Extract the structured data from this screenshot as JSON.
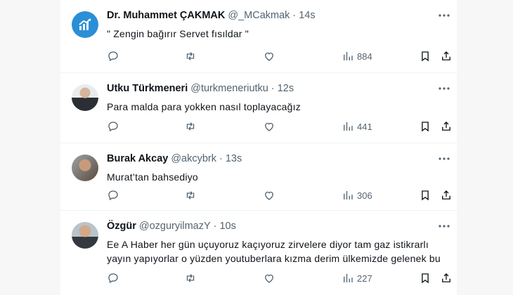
{
  "colors": {
    "text": "#0f1419",
    "muted": "#536471",
    "divider": "#eff3f4",
    "brand_avatar": "#2a8fd6"
  },
  "tweets": [
    {
      "name": "Dr. Muhammet ÇAKMAK",
      "handle": "@_MCakmak",
      "sep": "·",
      "time": "14s",
      "text": "\" Zengin bağırır Servet fısıldar \"",
      "views": "884",
      "avatar_icon": "chart-logo-icon"
    },
    {
      "name": "Utku Türkmeneri",
      "handle": "@turkmeneriutku",
      "sep": "·",
      "time": "12s",
      "text": "Para malda para yokken nasıl toplayacağız",
      "views": "441"
    },
    {
      "name": "Burak Akcay",
      "handle": "@akcybrk",
      "sep": "·",
      "time": "13s",
      "text": "Murat’tan bahsediyo",
      "views": "306"
    },
    {
      "name": "Özgür",
      "handle": "@ozguryilmazY",
      "sep": "·",
      "time": "10s",
      "text": "Ee A Haber her gün uçuyoruz kaçıyoruz zirvelere diyor tam gaz istikrarlı yayın yapıyorlar o yüzden youtuberlara kızma derim ülkemizde gelenek bu",
      "views": "227"
    }
  ],
  "icons": [
    "more-icon",
    "reply-icon",
    "retweet-icon",
    "like-icon",
    "views-icon",
    "bookmark-icon",
    "share-icon"
  ]
}
